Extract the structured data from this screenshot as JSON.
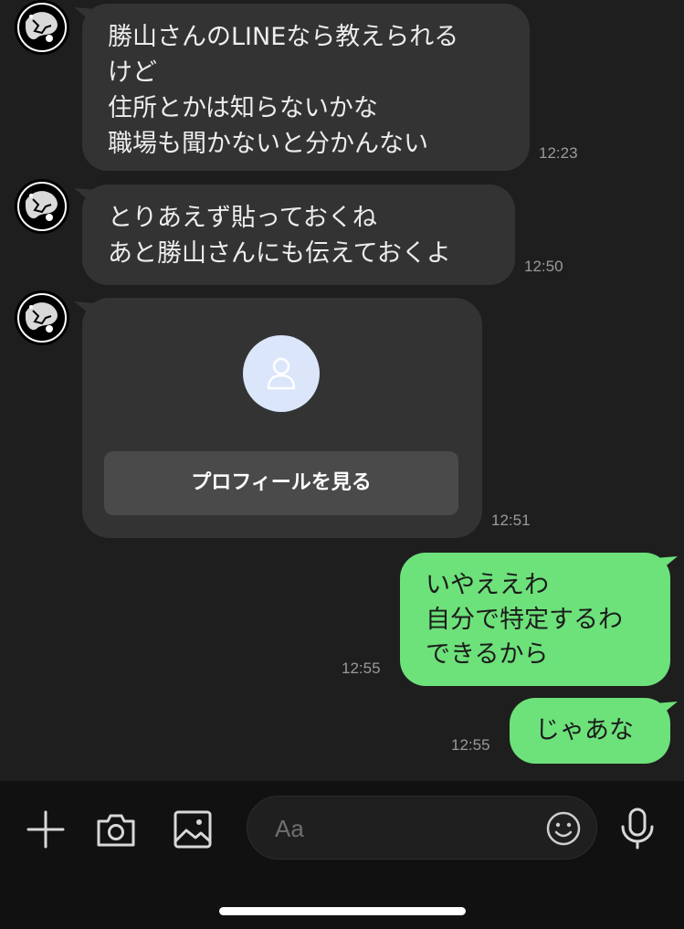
{
  "messages": [
    {
      "lines": [
        "勝山さんのLINEなら教えられる",
        "けど",
        "住所とかは知らないかな",
        "職場も聞かないと分かんない"
      ],
      "time": "12:23"
    },
    {
      "lines": [
        "とりあえず貼っておくね",
        "あと勝山さんにも伝えておくよ"
      ],
      "time": "12:50"
    },
    {
      "profile_card": {
        "button_label": "プロフィールを見る",
        "avatar_icon": "person-icon"
      },
      "time": "12:51"
    },
    {
      "lines": [
        "いやええわ",
        "自分で特定するわ",
        "できるから"
      ],
      "time": "12:55"
    },
    {
      "lines": [
        "じゃあな"
      ],
      "time": "12:55"
    }
  ],
  "input_bar": {
    "placeholder": "Aa",
    "icons": [
      "plus-icon",
      "camera-icon",
      "image-icon",
      "emoji-icon",
      "microphone-icon"
    ]
  },
  "colors": {
    "background": "#1e1e1e",
    "incoming_bubble": "#333333",
    "outgoing_bubble": "#6de17a",
    "bottom_bar": "#111111"
  }
}
